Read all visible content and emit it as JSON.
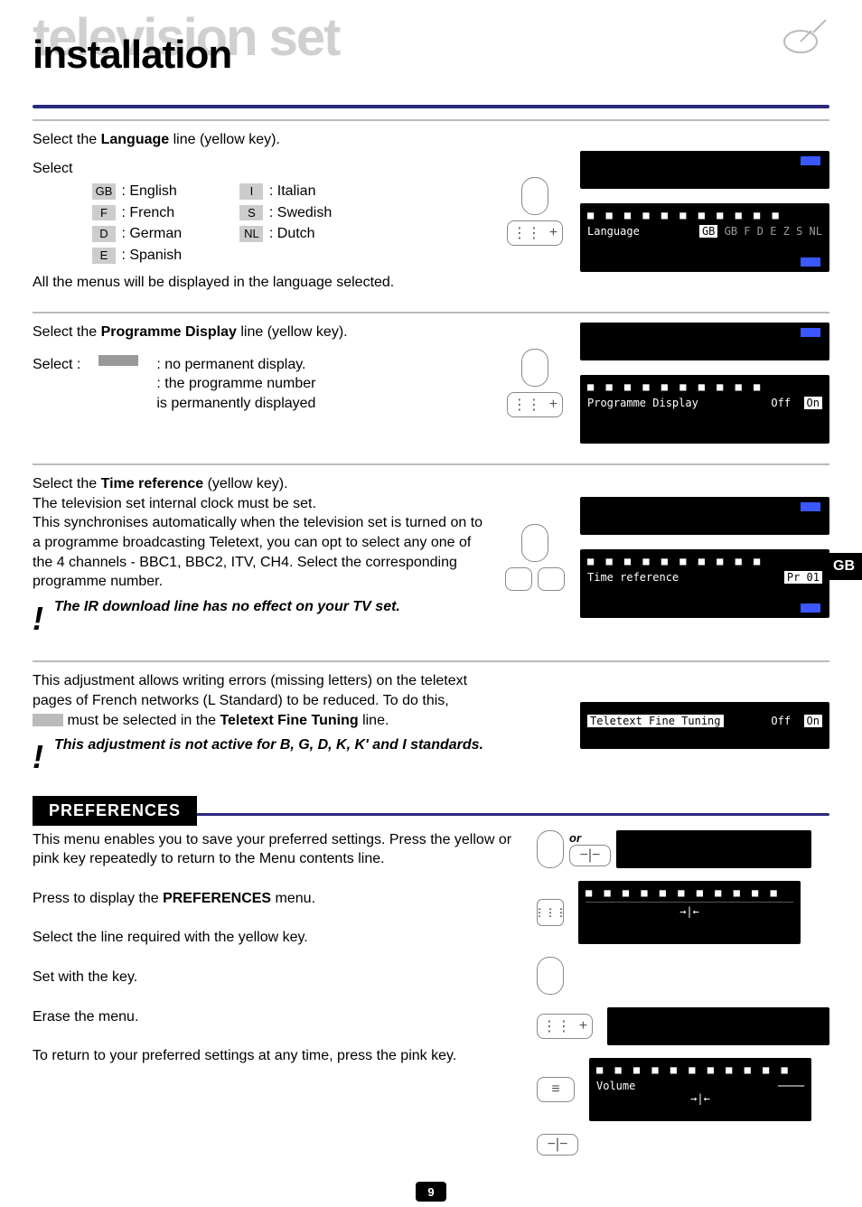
{
  "header": {
    "ghost": "television set",
    "title": "installation"
  },
  "tab": "GB",
  "lang_section": {
    "line1_a": "Select the ",
    "line1_b": "Language",
    "line1_c": " line (yellow key).",
    "select_label": "Select",
    "codes": {
      "GB": "GB",
      "F": "F",
      "D": "D",
      "E": "E",
      "I": "I",
      "S": "S",
      "NL": "NL"
    },
    "names": {
      "GB": ": English",
      "F": ": French",
      "D": ": German",
      "E": ": Spanish",
      "I": ": Italian",
      "S": ": Swedish",
      "NL": ": Dutch"
    },
    "line2": "All the menus will be displayed in the language selected.",
    "osd": {
      "label": "Language",
      "opts": "GB  F  D  E  Z  S  NL",
      "sel": "GB"
    }
  },
  "prog_section": {
    "line1_a": "Select the ",
    "line1_b": "Programme Display",
    "line1_c": " line (yellow key).",
    "select_label": "Select :",
    "opt1": ": no permanent display.",
    "opt2": ": the programme number",
    "opt3": "  is permanently displayed",
    "osd": {
      "label": "Programme Display",
      "off": "Off",
      "on": "On"
    }
  },
  "time_section": {
    "line1_a": "Select the ",
    "line1_b": "Time reference",
    "line1_c": " (yellow key).",
    "line2": "The television set internal clock must be set.",
    "line3": "This synchronises automatically when the television set is turned on to a programme broadcasting Teletext, you can opt to select any one of the 4 channels - BBC1, BBC2, ITV, CH4. Select the corresponding programme number.",
    "note": "The IR download line has no effect on your TV set.",
    "osd": {
      "label": "Time reference",
      "val": "Pr 01"
    }
  },
  "tt_section": {
    "line1": "This adjustment allows writing errors (missing letters) on the teletext pages of French networks (L Standard) to be reduced. To do this,",
    "line2_a": " must be selected in the ",
    "line2_b": "Teletext Fine Tuning",
    "line2_c": " line.",
    "note": "This adjustment is not active for B, G, D, K, K' and I standards.",
    "osd": {
      "label": "Teletext Fine Tuning",
      "off": "Off",
      "on": "On"
    }
  },
  "pref_heading": "PREFERENCES",
  "pref_section": {
    "p1": "This menu enables you to save your preferred settings. Press the yellow or pink key repeatedly to return to the Menu contents line.",
    "p2_a": "Press to display the ",
    "p2_b": "PREFERENCES",
    "p2_c": " menu.",
    "p3": "Select the line required with the yellow key.",
    "p4": "Set with the key.",
    "p5": "Erase the menu.",
    "p6": "To return to your preferred settings at any time, press the pink key.",
    "or": "or",
    "osd1": {
      "vol": "Volume"
    }
  },
  "icons": {
    "plus": "+",
    "minus": "−",
    "menu": "≡",
    "arrows": "→|←"
  },
  "page_num": "9"
}
